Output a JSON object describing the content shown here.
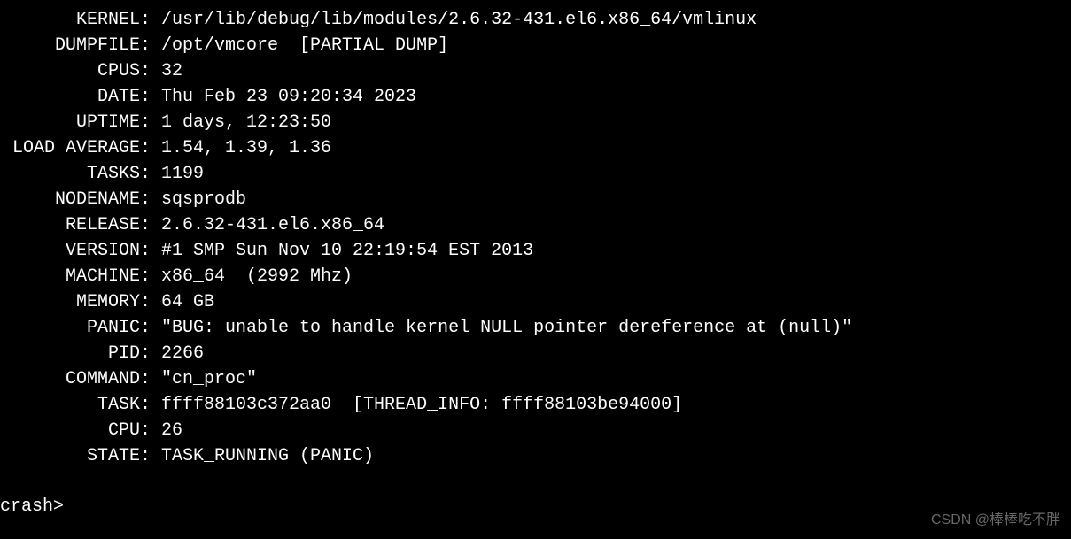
{
  "crash": {
    "kernel_label": "KERNEL:",
    "kernel_value": "/usr/lib/debug/lib/modules/2.6.32-431.el6.x86_64/vmlinux",
    "dumpfile_label": "DUMPFILE:",
    "dumpfile_value": "/opt/vmcore  [PARTIAL DUMP]",
    "cpus_label": "CPUS:",
    "cpus_value": "32",
    "date_label": "DATE:",
    "date_value": "Thu Feb 23 09:20:34 2023",
    "uptime_label": "UPTIME:",
    "uptime_value": "1 days, 12:23:50",
    "loadavg_label": "LOAD AVERAGE:",
    "loadavg_value": "1.54, 1.39, 1.36",
    "tasks_label": "TASKS:",
    "tasks_value": "1199",
    "nodename_label": "NODENAME:",
    "nodename_value": "sqsprodb",
    "release_label": "RELEASE:",
    "release_value": "2.6.32-431.el6.x86_64",
    "version_label": "VERSION:",
    "version_value": "#1 SMP Sun Nov 10 22:19:54 EST 2013",
    "machine_label": "MACHINE:",
    "machine_value": "x86_64  (2992 Mhz)",
    "memory_label": "MEMORY:",
    "memory_value": "64 GB",
    "panic_label": "PANIC:",
    "panic_value": "\"BUG: unable to handle kernel NULL pointer dereference at (null)\"",
    "pid_label": "PID:",
    "pid_value": "2266",
    "command_label": "COMMAND:",
    "command_value": "\"cn_proc\"",
    "task_label": "TASK:",
    "task_value": "ffff88103c372aa0  [THREAD_INFO: ffff88103be94000]",
    "cpu_label": "CPU:",
    "cpu_value": "26",
    "state_label": "STATE:",
    "state_value": "TASK_RUNNING (PANIC)"
  },
  "prompt": "crash>",
  "watermark": "CSDN @棒棒吃不胖"
}
